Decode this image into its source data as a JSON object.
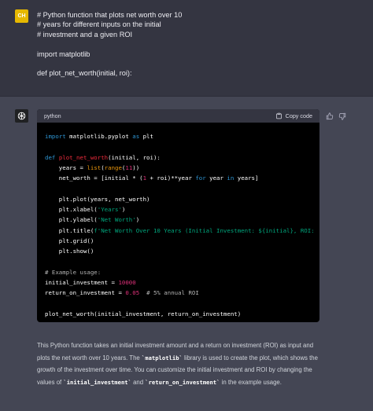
{
  "user": {
    "avatar_initials": "CH",
    "prompt": "# Python function that plots net worth over 10\n# years for different inputs on the initial\n# investment and a given ROI\n\nimport matplotlib\n\ndef plot_net_worth(initial, roi):"
  },
  "assistant": {
    "code_language": "python",
    "copy_label": "Copy code",
    "answer_parts": [
      "This Python function takes an initial investment amount and a return on investment (ROI) as input and plots the net worth over 10 years. The ",
      "`matplotlib`",
      " library is used to create the plot, which shows the growth of the investment over time. You can customize the initial investment and ROI by changing the values of ",
      "`initial_investment`",
      " and ",
      "`return_on_investment`",
      " in the example usage."
    ]
  },
  "colors": {
    "user_bg": "#343541",
    "assistant_bg": "#444654",
    "code_bg": "#000000",
    "avatar_user": "#e6b800"
  },
  "icons": [
    "openai-logo-icon",
    "clipboard-icon",
    "thumbs-up-icon",
    "thumbs-down-icon"
  ]
}
